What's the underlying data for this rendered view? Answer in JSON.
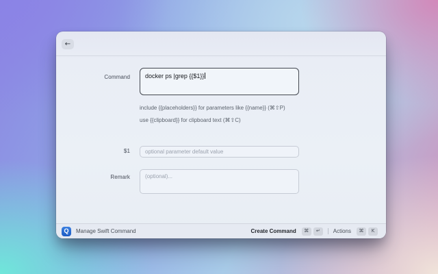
{
  "window": {
    "header": {
      "back_icon": "←"
    },
    "form": {
      "command": {
        "label": "Command",
        "value": "docker ps |grep {{$1}}",
        "help_placeholders": "include {{placeholders}} for parameters like {{name}} (⌘⇧P)",
        "help_clipboard": "use {{clipboard}} for clipboard text (⌘⇧C)"
      },
      "param1": {
        "label": "$1",
        "placeholder": "optional parameter default value"
      },
      "remark": {
        "label": "Remark",
        "placeholder": "(optional)..."
      }
    },
    "footer": {
      "app_icon_glyph": "Q",
      "app_name": "Manage Swift Command",
      "primary_action": {
        "label": "Create Command",
        "key1": "⌘",
        "key2": "↵"
      },
      "secondary_action": {
        "label": "Actions",
        "key1": "⌘",
        "key2": "K"
      }
    }
  },
  "colors": {
    "app_icon_blue": "#1d5cc4",
    "focused_border": "#43474f",
    "field_border": "#c6cbd5",
    "bg_corner_top_left": "#8b83e6",
    "bg_corner_top_right": "#d289ba",
    "bg_corner_bottom_left": "#6fe7da",
    "bg_corner_bottom_right": "#f0e4da"
  }
}
